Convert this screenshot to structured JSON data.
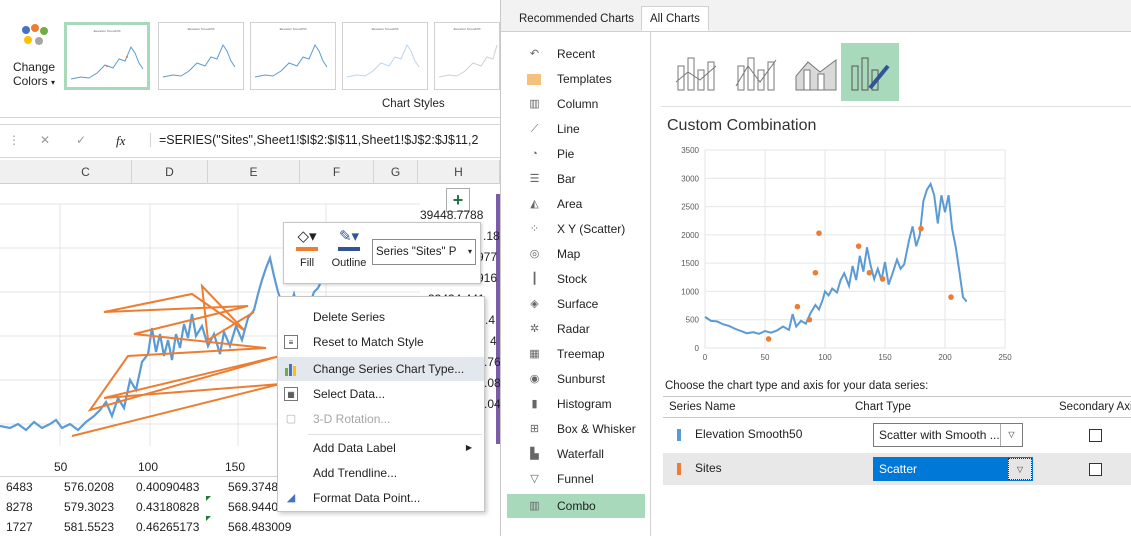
{
  "ribbon": {
    "change_colors_line1": "Change",
    "change_colors_line2": "Colors",
    "chart_styles_label": "Chart Styles",
    "thumb_titles": [
      "Elevation Smooth50",
      "Elevation Smooth50",
      "Elevation Smooth50",
      "Elevation Smooth50",
      "Elevation Smooth50"
    ]
  },
  "formula_bar": {
    "cancel": "✕",
    "enter": "✓",
    "fx": "fx",
    "formula": "=SERIES(\"Sites\",Sheet1!$I$2:$I$11,Sheet1!$J$2:$J$11,2"
  },
  "columns": [
    "C",
    "D",
    "E",
    "F",
    "G",
    "H"
  ],
  "h_values": [
    "39448.7788",
    ".18",
    "977",
    "916",
    "33434.441",
    ".4",
    "4",
    ".76",
    ".08",
    ".04"
  ],
  "axis_ticks": [
    "50",
    "100",
    "150"
  ],
  "rows": [
    {
      "c": "6483",
      "d": "576.0208",
      "e": "0.40090483",
      "f": "569.3748"
    },
    {
      "c": "8278",
      "d": "579.3023",
      "e": "0.43180828",
      "f": "568.9440"
    },
    {
      "c": "1727",
      "d": "581.5523",
      "e": "0.46265173",
      "f": "568.483009"
    }
  ],
  "mini_toolbar": {
    "fill": "Fill",
    "outline": "Outline",
    "series_dropdown": "Series \"Sites\" P"
  },
  "context_menu": [
    "Delete Series",
    "Reset to Match Style",
    "Change Series Chart Type...",
    "Select Data...",
    "3-D Rotation...",
    "Add Data Label",
    "Add Trendline...",
    "Format Data Point..."
  ],
  "dialog": {
    "tabs": [
      "Recommended Charts",
      "All Charts"
    ],
    "types": [
      "Recent",
      "Templates",
      "Column",
      "Line",
      "Pie",
      "Bar",
      "Area",
      "X Y (Scatter)",
      "Map",
      "Stock",
      "Surface",
      "Radar",
      "Treemap",
      "Sunburst",
      "Histogram",
      "Box & Whisker",
      "Waterfall",
      "Funnel",
      "Combo"
    ],
    "section_title": "Custom Combination",
    "choose_label": "Choose the chart type and axis for your data series:",
    "grid_headers": [
      "Series Name",
      "Chart Type",
      "Secondary Axi"
    ],
    "series": [
      {
        "name": "Elevation Smooth50",
        "chart_type": "Scatter with Smooth ...",
        "color": "#5b9bd5",
        "secondary": false
      },
      {
        "name": "Sites",
        "chart_type": "Scatter",
        "color": "#ed7d31",
        "secondary": false
      }
    ]
  },
  "chart_data": {
    "type": "scatter",
    "xlim": [
      0,
      250
    ],
    "ylim": [
      0,
      3500
    ],
    "x_ticks": [
      0,
      50,
      100,
      150,
      200,
      250
    ],
    "y_ticks": [
      0,
      500,
      1000,
      1500,
      2000,
      2500,
      3000,
      3500
    ],
    "series": [
      {
        "name": "Elevation Smooth50",
        "color": "#5b9bd5",
        "line": true,
        "points": [
          [
            0,
            550
          ],
          [
            5,
            480
          ],
          [
            10,
            470
          ],
          [
            15,
            420
          ],
          [
            20,
            390
          ],
          [
            25,
            340
          ],
          [
            30,
            300
          ],
          [
            35,
            260
          ],
          [
            40,
            280
          ],
          [
            45,
            250
          ],
          [
            50,
            300
          ],
          [
            55,
            270
          ],
          [
            60,
            310
          ],
          [
            65,
            380
          ],
          [
            70,
            320
          ],
          [
            73,
            600
          ],
          [
            76,
            380
          ],
          [
            80,
            480
          ],
          [
            84,
            430
          ],
          [
            88,
            620
          ],
          [
            92,
            760
          ],
          [
            95,
            680
          ],
          [
            98,
            850
          ],
          [
            100,
            1000
          ],
          [
            103,
            930
          ],
          [
            106,
            1050
          ],
          [
            110,
            980
          ],
          [
            113,
            1200
          ],
          [
            116,
            1320
          ],
          [
            120,
            1100
          ],
          [
            123,
            1450
          ],
          [
            126,
            1200
          ],
          [
            129,
            1630
          ],
          [
            132,
            1350
          ],
          [
            135,
            1780
          ],
          [
            138,
            1460
          ],
          [
            141,
            1220
          ],
          [
            144,
            1400
          ],
          [
            147,
            1200
          ],
          [
            150,
            1520
          ],
          [
            153,
            1120
          ],
          [
            156,
            1300
          ],
          [
            160,
            1560
          ],
          [
            163,
            1400
          ],
          [
            166,
            1480
          ],
          [
            170,
            1900
          ],
          [
            173,
            2150
          ],
          [
            176,
            1800
          ],
          [
            179,
            2000
          ],
          [
            182,
            2600
          ],
          [
            185,
            2800
          ],
          [
            188,
            2900
          ],
          [
            191,
            2700
          ],
          [
            194,
            2200
          ],
          [
            197,
            2700
          ],
          [
            200,
            2400
          ],
          [
            203,
            2700
          ],
          [
            206,
            2100
          ],
          [
            209,
            1780
          ],
          [
            212,
            1350
          ],
          [
            215,
            900
          ],
          [
            218,
            820
          ]
        ]
      },
      {
        "name": "Sites",
        "color": "#ed7d31",
        "line": false,
        "points": [
          [
            53,
            160
          ],
          [
            77,
            730
          ],
          [
            87,
            500
          ],
          [
            92,
            1330
          ],
          [
            95,
            2030
          ],
          [
            128,
            1800
          ],
          [
            137,
            1330
          ],
          [
            148,
            1220
          ],
          [
            180,
            2110
          ],
          [
            205,
            900
          ]
        ]
      }
    ]
  }
}
